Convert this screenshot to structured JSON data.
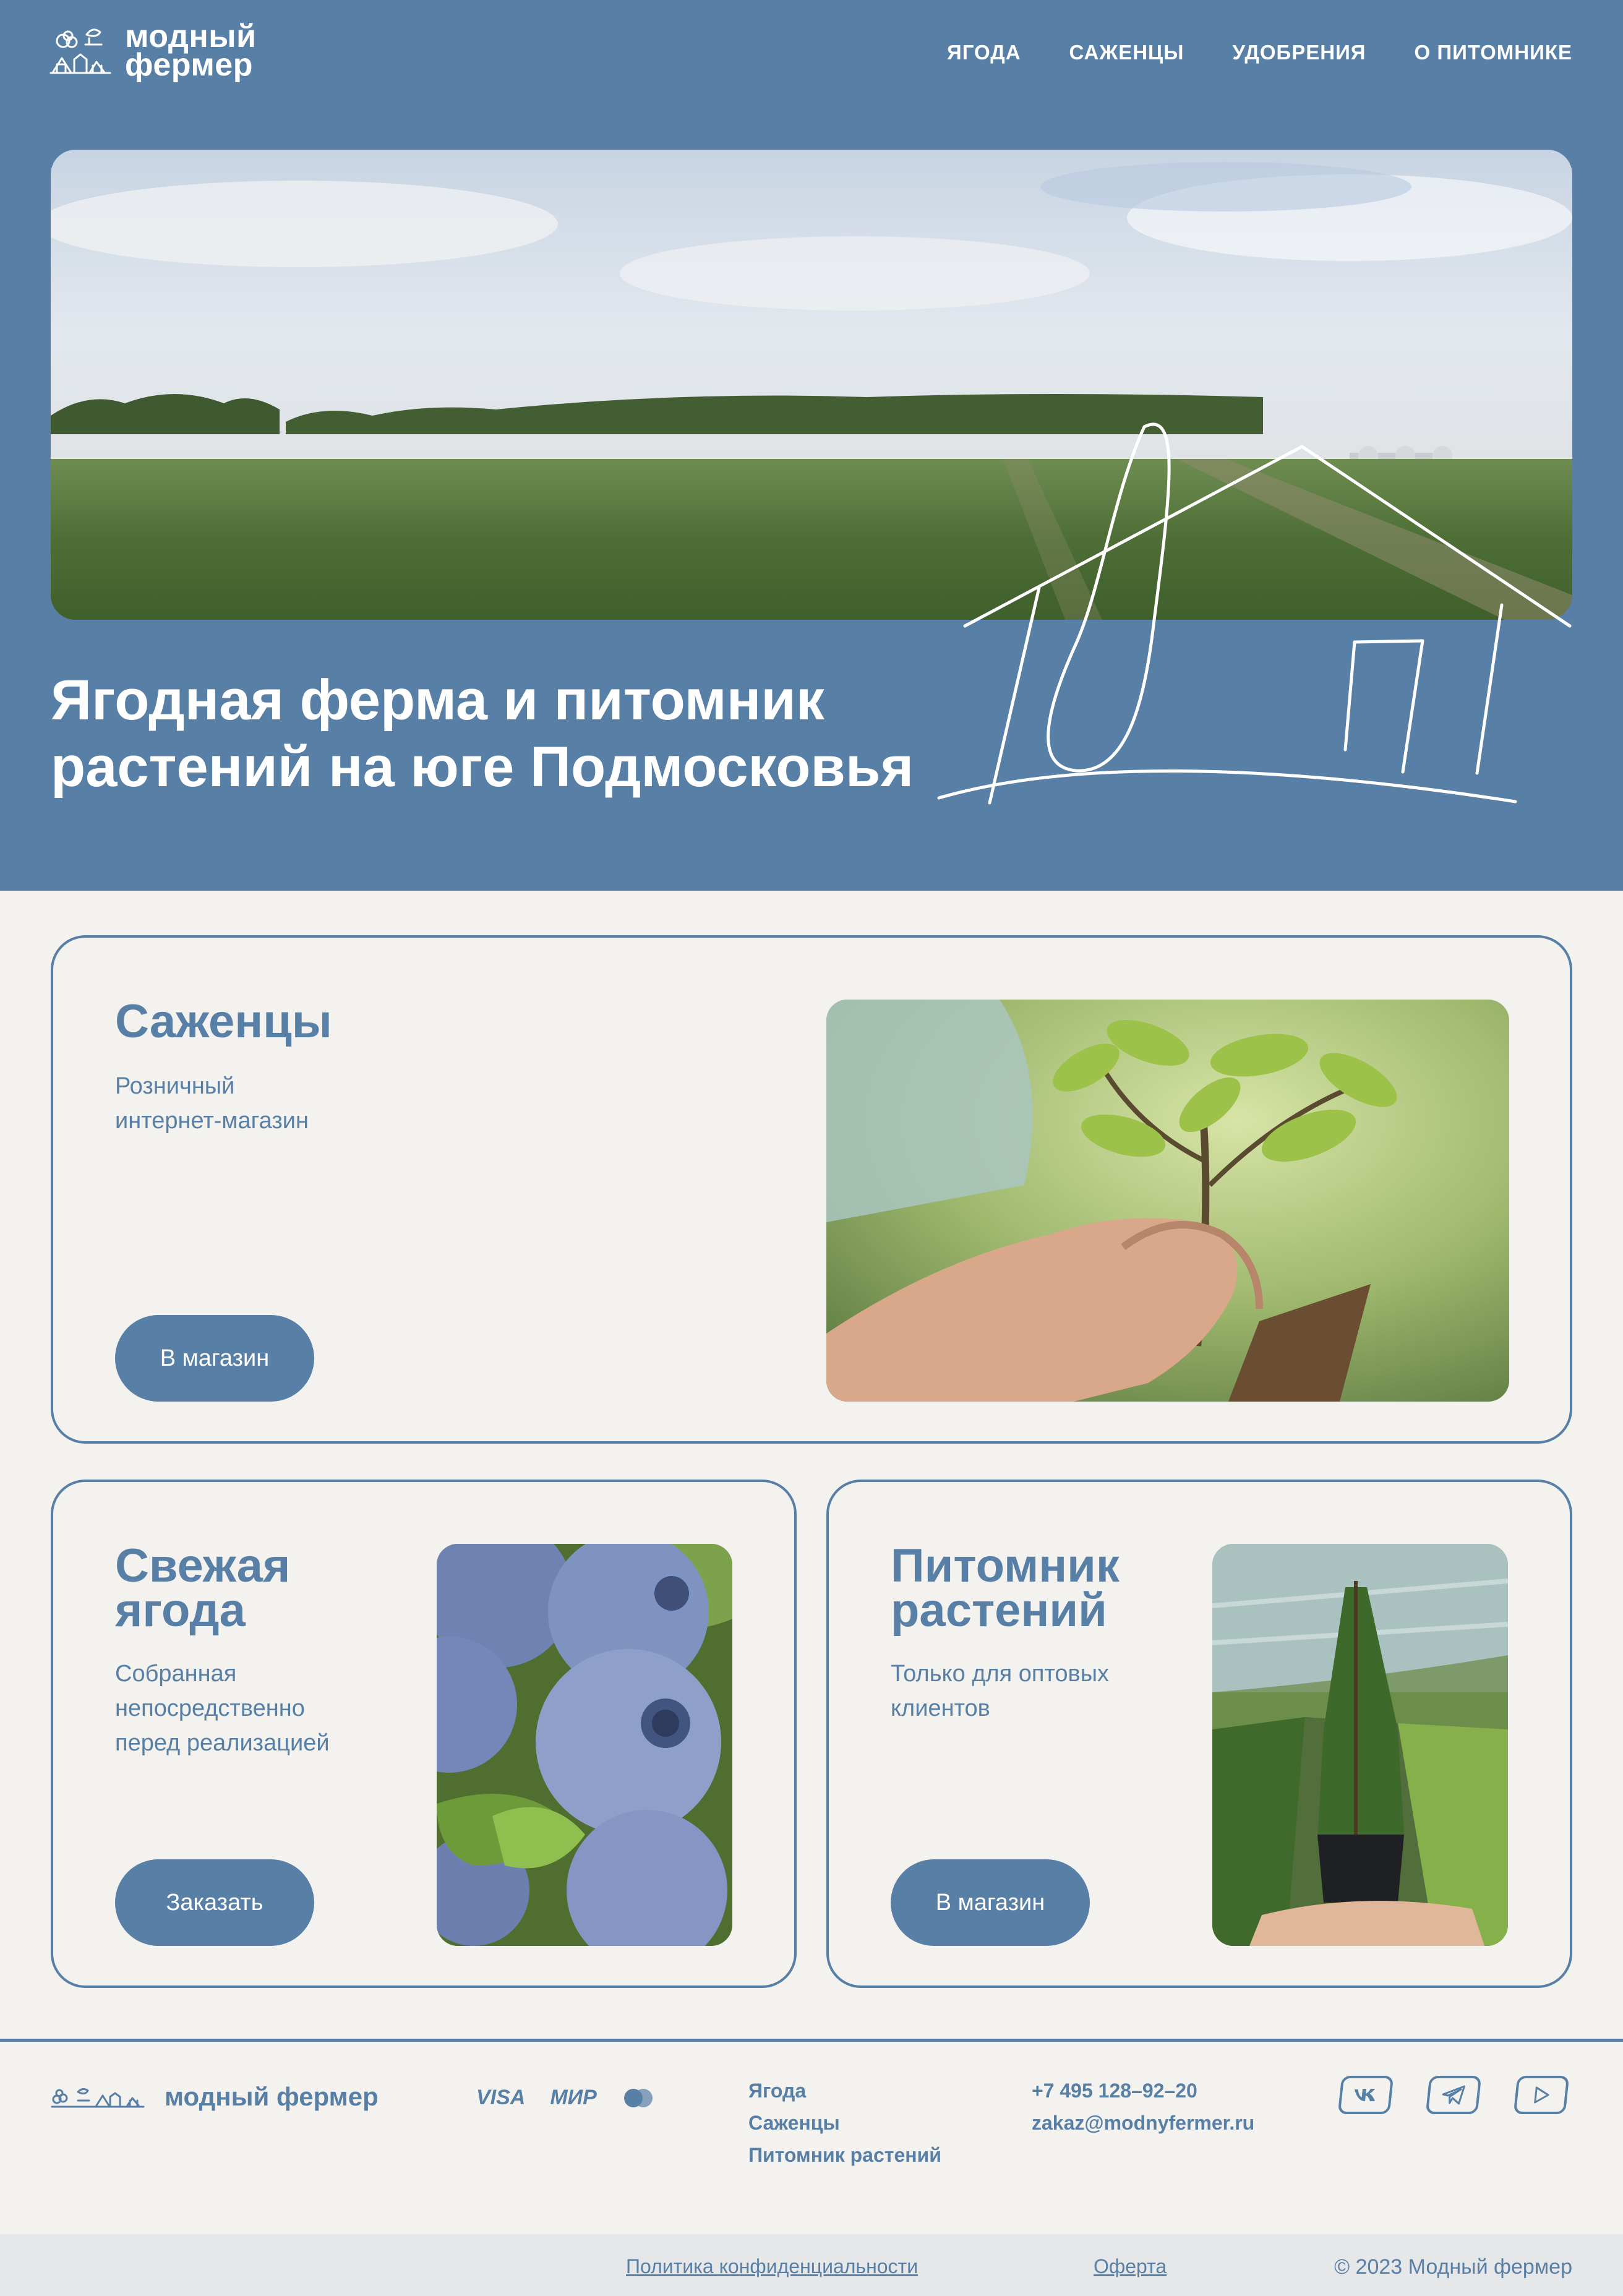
{
  "brand": {
    "name_line1": "модный",
    "name_line2": "фермер",
    "footer_name": "модный фермер"
  },
  "nav": {
    "items": [
      "ЯГОДА",
      "САЖЕНЦЫ",
      "УДОБРЕНИЯ",
      "О ПИТОМНИКЕ"
    ]
  },
  "hero": {
    "title_line1": "Ягодная ферма и питомник",
    "title_line2": "растений на юге Подмосковья"
  },
  "cards": {
    "seedlings": {
      "title": "Саженцы",
      "desc_line1": "Розничный",
      "desc_line2": "интернет-магазин",
      "button": "В магазин"
    },
    "berry": {
      "title_line1": "Свежая",
      "title_line2": "ягода",
      "desc_line1": "Собранная",
      "desc_line2": "непосредственно",
      "desc_line3": "перед реализацией",
      "button": "Заказать"
    },
    "nursery": {
      "title_line1": "Питомник",
      "title_line2": "растений",
      "desc_line1": "Только для оптовых",
      "desc_line2": "клиентов",
      "button": "В магазин"
    }
  },
  "footer": {
    "payments": [
      "VISA",
      "МИР"
    ],
    "links": [
      "Ягода",
      "Саженцы",
      "Питомник растений"
    ],
    "phone": "+7 495 128–92–20",
    "email": "zakaz@modnyfermer.ru",
    "socials": [
      "vk-icon",
      "telegram-icon",
      "youtube-icon"
    ],
    "privacy": "Политика конфиденциальности",
    "offer": "Оферта",
    "copyright": "© 2023 Модный фермер"
  },
  "colors": {
    "primary": "#587fa6",
    "background": "#f3f2ee",
    "bottom_bar": "#e6e7e9"
  }
}
